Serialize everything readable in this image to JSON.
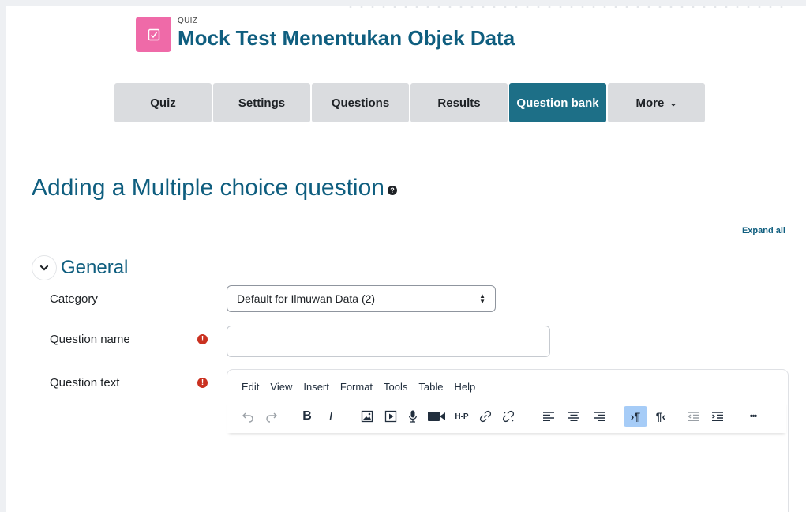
{
  "header": {
    "pre_title": "QUIZ",
    "title": "Mock Test Menentukan Objek Data",
    "icon": "quiz-checkbox-icon",
    "icon_color": "#ef6aa8"
  },
  "tabs": [
    {
      "label": "Quiz",
      "active": false
    },
    {
      "label": "Settings",
      "active": false
    },
    {
      "label": "Questions",
      "active": false
    },
    {
      "label": "Results",
      "active": false
    },
    {
      "label": "Question bank",
      "active": true
    },
    {
      "label": "More",
      "active": false,
      "has_dropdown": true
    }
  ],
  "page": {
    "heading": "Adding a Multiple choice question",
    "expand_all": "Expand all"
  },
  "section": {
    "title": "General",
    "collapsed": false
  },
  "form": {
    "category_label": "Category",
    "category_value": "Default for Ilmuwan Data (2)",
    "question_name_label": "Question name",
    "question_name_value": "",
    "question_text_label": "Question text"
  },
  "editor": {
    "menu": [
      "Edit",
      "View",
      "Insert",
      "Format",
      "Tools",
      "Table",
      "Help"
    ],
    "toolbar": [
      "undo-icon",
      "redo-icon",
      "bold-icon",
      "italic-icon",
      "image-icon",
      "media-icon",
      "microphone-icon",
      "video-camera-icon",
      "h5p-icon",
      "link-icon",
      "unlink-icon",
      "align-left-icon",
      "align-center-icon",
      "align-right-icon",
      "ltr-direction-icon",
      "rtl-direction-icon",
      "outdent-icon",
      "indent-icon",
      "more-icon"
    ],
    "h5p_label": "H-P",
    "more_label": "•••"
  },
  "colors": {
    "accent": "#0f5e7f",
    "active_tab": "#1d6f87",
    "tab_bg": "#dadcdf",
    "required": "#ca3120",
    "active_toolbar_button": "#a6ccf7"
  }
}
